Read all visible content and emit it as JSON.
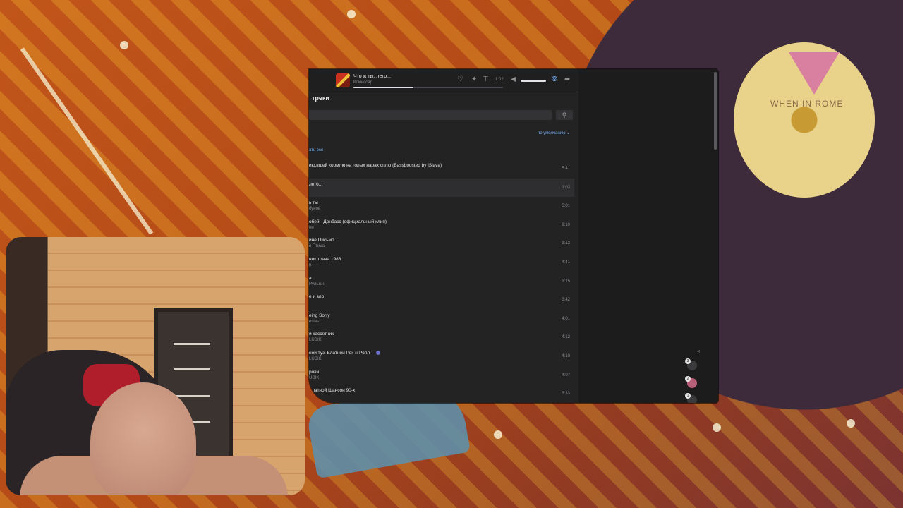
{
  "player": {
    "now_playing_title": "Что ж ты, лето...",
    "now_playing_artist": "Комиссар",
    "elapsed_time": "1:02",
    "progress": 0.4,
    "icons": [
      "dislike-icon",
      "recommend-icon",
      "lyrics-icon",
      "volume-icon",
      "broadcast-icon",
      "share-icon"
    ]
  },
  "page": {
    "section_title": "треки",
    "search_icon": "search-icon",
    "sort_label": "по умолчанию",
    "listen_all_label": "ать все"
  },
  "tracks": [
    {
      "title": "ию,вшей кормлю на голых нарах сплю (Bassboosted by iSlava)",
      "artist": "",
      "duration": "5:41"
    },
    {
      "title": "лето...",
      "artist": "",
      "duration": "1:03"
    },
    {
      "title": "ь ты",
      "artist": "бунов",
      "duration": "5:01"
    },
    {
      "title": "обей - Донбасс (официальный клип)",
      "artist": "ен",
      "duration": "6:10"
    },
    {
      "title": "ине Письмо",
      "artist": "я Птица",
      "duration": "3:13"
    },
    {
      "title": "ник трава 1988",
      "artist": "н",
      "duration": "4:41"
    },
    {
      "title": "а",
      "artist": "Рулькин",
      "duration": "3:15"
    },
    {
      "title": "е и зло",
      "artist": "",
      "duration": "3:42"
    },
    {
      "title": "eing Sorry",
      "artist": "esias",
      "duration": "4:01"
    },
    {
      "title": "й кассетник",
      "artist": "LUDIK",
      "duration": "4:12"
    },
    {
      "title": "ной туз: Блатной Рок-н-Ролл",
      "artist": "LUDIK",
      "duration": "4:10"
    },
    {
      "title": "рови",
      "artist": "UDIK",
      "duration": "4:07"
    },
    {
      "title": "Блатной Шансон 90-х",
      "artist": "",
      "duration": "3:33"
    }
  ],
  "side_panel": {
    "collapse_icon": "«",
    "avatars": [
      "3",
      "2",
      "1"
    ]
  },
  "background": {
    "record_label_text": "WHEN IN ROME"
  },
  "colors": {
    "app_bg": "#232324",
    "accent": "#71aaeb",
    "text_primary": "#e6e6e6",
    "text_secondary": "#8d8d92"
  }
}
